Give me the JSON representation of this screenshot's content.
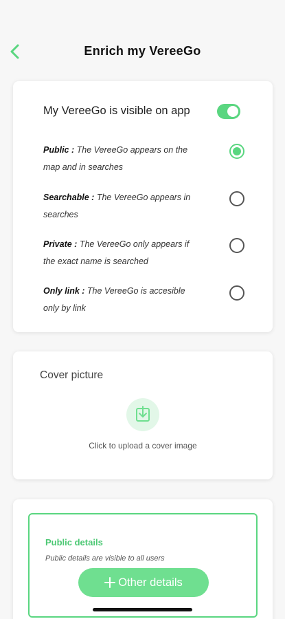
{
  "header": {
    "title": "Enrich my VereeGo"
  },
  "visibility": {
    "label": "My VereeGo is visible on app",
    "toggle_on": true,
    "options": [
      {
        "name": "Public :",
        "desc_line1": "The VereeGo appears on the",
        "desc_line2": "map and in searches",
        "selected": true
      },
      {
        "name": "Searchable :",
        "desc_line1": "The VereeGo appears in",
        "desc_line2": "searches",
        "selected": false
      },
      {
        "name": "Private :",
        "desc_line1": "The VereeGo only appears if",
        "desc_line2": "the exact name is searched",
        "selected": false
      },
      {
        "name": "Only link :",
        "desc_line1": "The VereeGo is accesible",
        "desc_line2": "only by link",
        "selected": false
      }
    ]
  },
  "cover": {
    "title": "Cover picture",
    "hint": "Click to upload a cover image"
  },
  "public_details": {
    "title": "Public details",
    "subtitle": "Public details are visible to all users",
    "button_label": "Other details"
  },
  "colors": {
    "accent": "#5ad680",
    "accent_light": "#e2f7e8"
  },
  "icons": {
    "back": "chevron-left-icon",
    "upload": "upload-icon",
    "plus": "plus-icon"
  }
}
